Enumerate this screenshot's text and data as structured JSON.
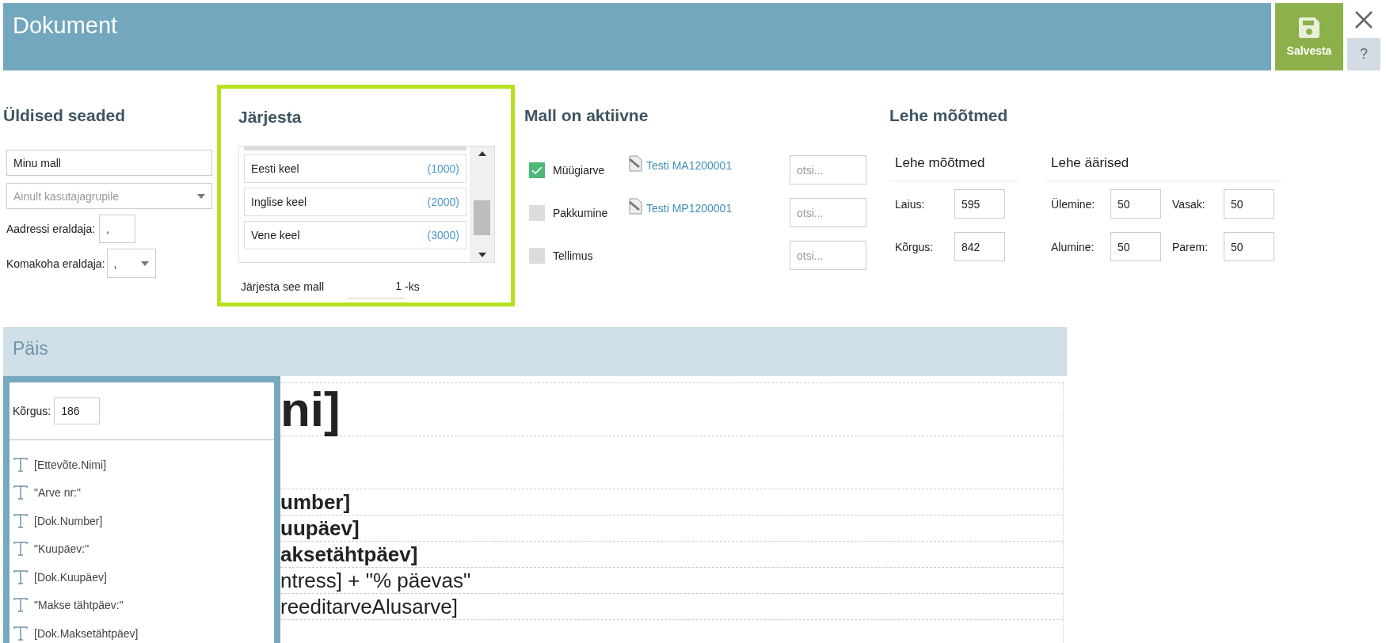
{
  "window": {
    "title": "Dokument"
  },
  "toolbar": {
    "save_button": "Salvesta",
    "help_button": "?"
  },
  "general": {
    "title": "Üldised seaded",
    "name_value": "Minu mall",
    "group_placeholder": "Ainult kasutajagrupile",
    "address_separator": {
      "label": "Aadressi eraldaja:",
      "value": ","
    },
    "decimal_separator": {
      "label": "Komakoha eraldaja:",
      "value": ","
    }
  },
  "sort": {
    "title": "Järjesta",
    "languages": [
      {
        "name": "Eesti keel",
        "order": "(1000)"
      },
      {
        "name": "Inglise keel",
        "order": "(2000)"
      },
      {
        "name": "Vene keel",
        "order": "(3000)"
      }
    ],
    "order_label": "Järjesta see mall",
    "order_value": "1",
    "order_unit": "-ks"
  },
  "active": {
    "title": "Mall on aktiivne",
    "documents": [
      {
        "label": "Müügiarve",
        "checked": true,
        "template": "Testi MA1200001",
        "search_placeholder": "otsi..."
      },
      {
        "label": "Pakkumine",
        "checked": false,
        "template": "Testi MP1200001",
        "search_placeholder": "otsi..."
      },
      {
        "label": "Tellimus",
        "checked": false,
        "search_placeholder": "otsi..."
      }
    ]
  },
  "page": {
    "title": "Lehe mõõtmed",
    "size": {
      "title": "Lehe mõõtmed",
      "fields": [
        {
          "label": "Laius:",
          "value": "595"
        },
        {
          "label": "Kõrgus:",
          "value": "842"
        }
      ]
    },
    "margins": {
      "title": "Lehe äärised",
      "fields": [
        {
          "label": "Ülemine:",
          "value": "50"
        },
        {
          "label": "Vasak:",
          "value": "50"
        },
        {
          "label": "Alumine:",
          "value": "50"
        },
        {
          "label": "Parem:",
          "value": "50"
        }
      ]
    }
  },
  "header_section": {
    "title": "Päis",
    "height_label": "Kõrgus:",
    "height_value": "186",
    "elements": [
      "[Ettevõte.Nimi]",
      "\"Arve nr:\"",
      "[Dok.Number]",
      "\"Kuupäev:\"",
      "[Dok.Kuupäev]",
      "\"Makse tähtpäev:\"",
      "[Dok.Maksetähtpäev]"
    ],
    "canvas_rows": [
      {
        "kind": "title",
        "text": "ni]"
      },
      {
        "kind": "spacer"
      },
      {
        "kind": "bold",
        "text": "umber]"
      },
      {
        "kind": "bold",
        "text": "uupäev]"
      },
      {
        "kind": "bold",
        "text": "aksetähtpäev]"
      },
      {
        "kind": "normal",
        "text": "ntress] + \"% päevas\""
      },
      {
        "kind": "normal",
        "text": "reeditarveAlusarve]"
      }
    ]
  }
}
